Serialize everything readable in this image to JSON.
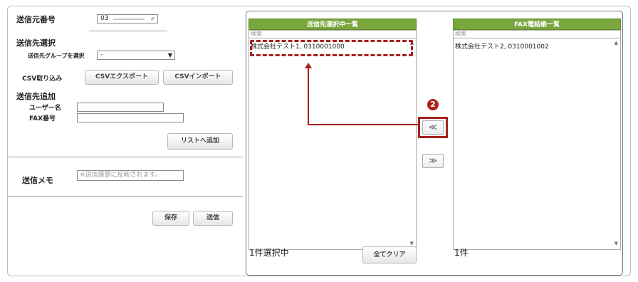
{
  "sender": {
    "label": "送信元番号",
    "value": "03"
  },
  "destination_select": {
    "heading": "送信先選択",
    "group_label": "送信先グループを選択",
    "group_value": "-"
  },
  "csv": {
    "label": "CSV取り込み",
    "export_label": "CSVエクスポート",
    "import_label": "CSVインポート"
  },
  "add_destination": {
    "heading": "送信先追加",
    "user_name_label": "ユーザー名",
    "user_name_value": "",
    "fax_label": "FAX番号",
    "fax_value": "",
    "add_button": "リストへ追加"
  },
  "memo": {
    "label": "送信メモ",
    "placeholder": "※送信履歴に反映されます。"
  },
  "actions": {
    "save_label": "保存",
    "send_label": "送信"
  },
  "selected_list": {
    "title": "送信先選択中一覧",
    "search_placeholder": "検索",
    "items": [
      "株式会社テスト1, 0310001000"
    ],
    "count_text": "1件選択中",
    "clear_button": "全てクリア"
  },
  "phonebook_list": {
    "title": "FAX電話帳一覧",
    "search_placeholder": "検索",
    "items": [
      "株式会社テスト2, 0310001002"
    ],
    "count_text": "1件"
  },
  "move_buttons": {
    "add_label": "≪",
    "remove_label": "≫"
  },
  "annotation": {
    "step_number": "2"
  },
  "colors": {
    "list_header": "#7aa63e",
    "annotation_red": "#a5221c"
  }
}
